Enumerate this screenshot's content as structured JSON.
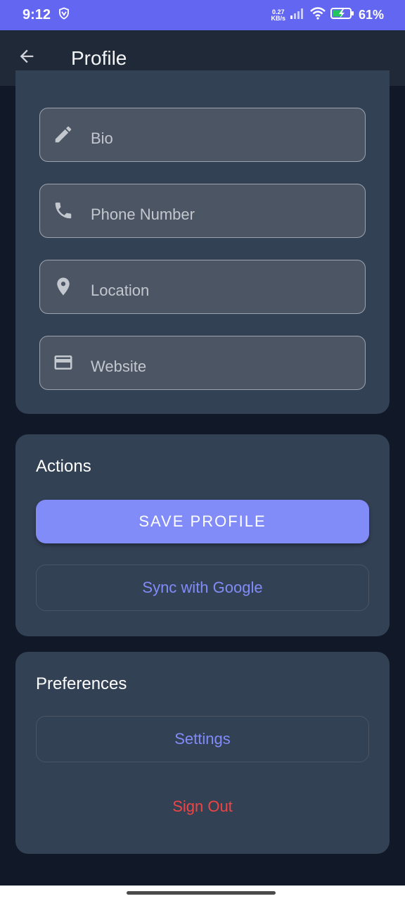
{
  "status_bar": {
    "time": "9:12",
    "net_speed_value": "0.27",
    "net_speed_unit": "KB/s",
    "battery": "61%",
    "icons": [
      "shield-icon",
      "signal-icon",
      "wifi-icon",
      "battery-icon"
    ],
    "color": "#6366f1"
  },
  "app_bar": {
    "title": "Profile",
    "back_icon": "arrow-back-icon"
  },
  "fields": [
    {
      "icon": "pencil-icon",
      "placeholder": "Bio",
      "value": ""
    },
    {
      "icon": "phone-icon",
      "placeholder": "Phone Number",
      "value": ""
    },
    {
      "icon": "location-pin-icon",
      "placeholder": "Location",
      "value": ""
    },
    {
      "icon": "card-icon",
      "placeholder": "Website",
      "value": ""
    }
  ],
  "actions": {
    "title": "Actions",
    "save_label": "SAVE PROFILE",
    "sync_label": "Sync with Google"
  },
  "preferences": {
    "title": "Preferences",
    "settings_label": "Settings",
    "sign_out_label": "Sign Out"
  },
  "colors": {
    "background": "#111827",
    "card": "#334155",
    "field": "#4b5563",
    "accent": "#818cf8",
    "danger": "#ef4444"
  }
}
